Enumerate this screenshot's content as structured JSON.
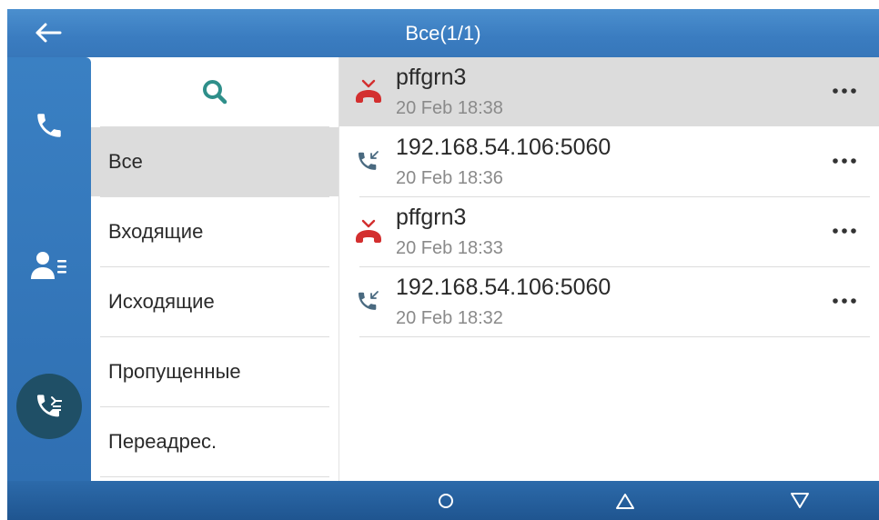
{
  "header": {
    "title": "Все(1/1)"
  },
  "categories": [
    {
      "label": "Все"
    },
    {
      "label": "Входящие"
    },
    {
      "label": "Исходящие"
    },
    {
      "label": "Пропущенные"
    },
    {
      "label": "Переадрес."
    }
  ],
  "calls": [
    {
      "name": "pffgrn3",
      "time": "20 Feb 18:38",
      "type": "missed",
      "icon": "missed-call-icon"
    },
    {
      "name": "192.168.54.106:5060",
      "time": "20 Feb 18:36",
      "type": "incoming",
      "icon": "incoming-call-icon"
    },
    {
      "name": "pffgrn3",
      "time": "20 Feb 18:33",
      "type": "missed",
      "icon": "missed-call-icon"
    },
    {
      "name": "192.168.54.106:5060",
      "time": "20 Feb 18:32",
      "type": "incoming",
      "icon": "incoming-call-icon"
    }
  ],
  "colors": {
    "topbar": "#3a7cc0",
    "rail": "#3377bb",
    "active_rail_circle": "#1f4f66",
    "search_icon": "#2f8f8a",
    "missed": "#d32f2f",
    "incoming_icon": "#4a6a80",
    "selected_row": "#dcdcdc"
  }
}
